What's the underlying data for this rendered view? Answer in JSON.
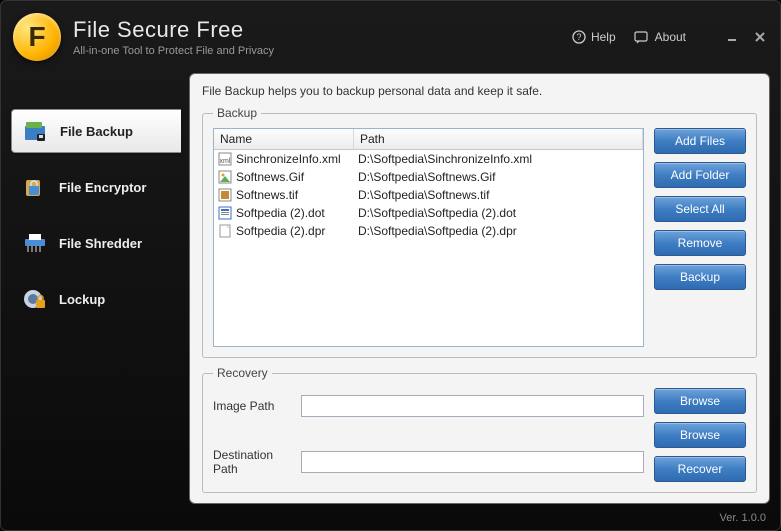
{
  "header": {
    "logo_letter": "F",
    "title": "File Secure Free",
    "subtitle": "All-in-one Tool to Protect File and Privacy",
    "help_label": "Help",
    "about_label": "About"
  },
  "sidebar": {
    "items": [
      {
        "label": "File Backup",
        "icon": "backup",
        "active": true
      },
      {
        "label": "File Encryptor",
        "icon": "lock",
        "active": false
      },
      {
        "label": "File Shredder",
        "icon": "shredder",
        "active": false
      },
      {
        "label": "Lockup",
        "icon": "lockup",
        "active": false
      }
    ]
  },
  "main": {
    "description": "File Backup helps you to backup personal data and keep it safe.",
    "backup": {
      "legend": "Backup",
      "columns": {
        "name": "Name",
        "path": "Path"
      },
      "rows": [
        {
          "name": "SinchronizeInfo.xml",
          "path": "D:\\Softpedia\\SinchronizeInfo.xml",
          "type": "xml"
        },
        {
          "name": "Softnews.Gif",
          "path": "D:\\Softpedia\\Softnews.Gif",
          "type": "gif"
        },
        {
          "name": "Softnews.tif",
          "path": "D:\\Softpedia\\Softnews.tif",
          "type": "tif"
        },
        {
          "name": "Softpedia (2).dot",
          "path": "D:\\Softpedia\\Softpedia (2).dot",
          "type": "dot"
        },
        {
          "name": "Softpedia (2).dpr",
          "path": "D:\\Softpedia\\Softpedia (2).dpr",
          "type": "dpr"
        }
      ],
      "buttons": {
        "add_files": "Add Files",
        "add_folder": "Add Folder",
        "select_all": "Select All",
        "remove": "Remove",
        "backup": "Backup"
      }
    },
    "recovery": {
      "legend": "Recovery",
      "image_path_label": "Image Path",
      "image_path_value": "",
      "dest_path_label": "Destination Path",
      "dest_path_value": "",
      "browse_label": "Browse",
      "recover_label": "Recover"
    }
  },
  "footer": {
    "version": "Ver. 1.0.0"
  }
}
